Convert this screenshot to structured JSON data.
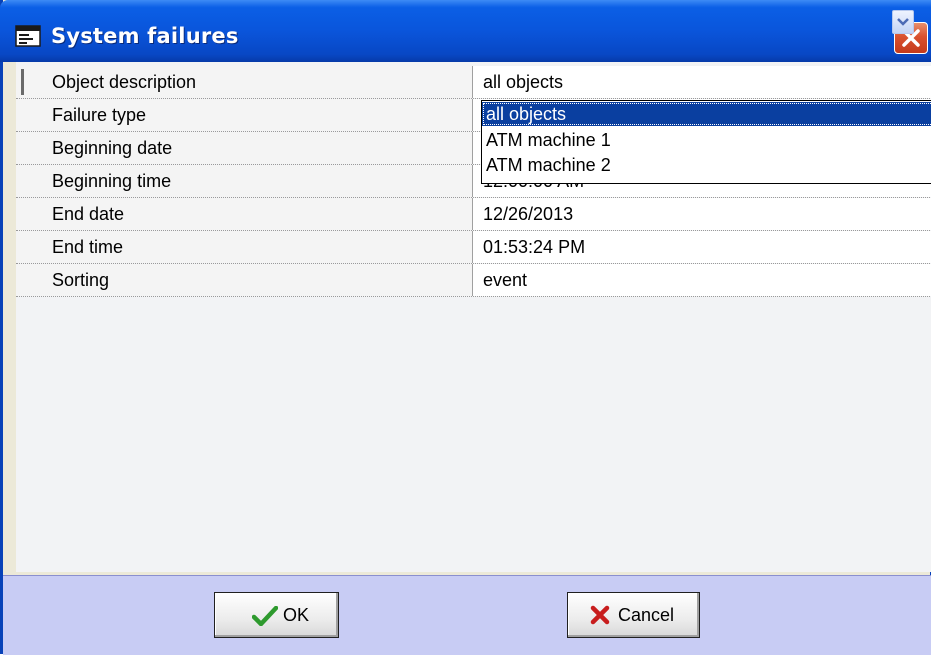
{
  "window": {
    "title": "System failures"
  },
  "grid": {
    "rows": [
      {
        "label": "Object description",
        "value": "all objects"
      },
      {
        "label": "Failure type",
        "value": ""
      },
      {
        "label": "Beginning date",
        "value": ""
      },
      {
        "label": "Beginning time",
        "value": "12:00:00 AM"
      },
      {
        "label": "End date",
        "value": "12/26/2013"
      },
      {
        "label": "End time",
        "value": "01:53:24 PM"
      },
      {
        "label": "Sorting",
        "value": "event"
      }
    ]
  },
  "dropdown": {
    "options": [
      "all objects",
      "ATM machine 1",
      "ATM machine 2"
    ],
    "selected": "all objects"
  },
  "buttons": {
    "ok_label": "OK",
    "cancel_label": "Cancel"
  },
  "colors": {
    "titlebar": "#0a55db",
    "selection": "#0a3fa0",
    "bottombar": "#c8ccf4",
    "ok_check": "#2e9a2e",
    "cancel_x": "#c81e1e"
  },
  "icons": {
    "window": "window-app-icon",
    "close": "close-icon",
    "combo": "chevron-down-icon",
    "ok": "checkmark-icon",
    "cancel": "red-x-icon"
  }
}
